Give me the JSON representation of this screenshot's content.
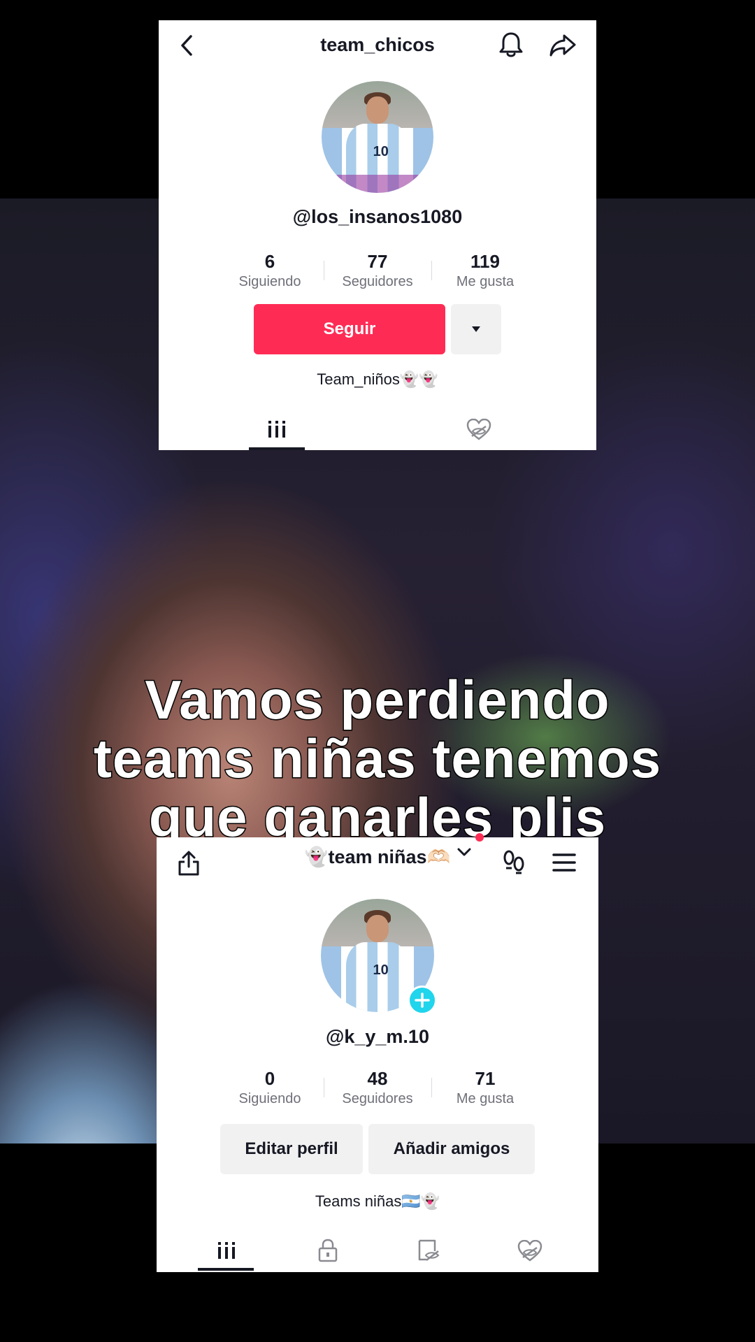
{
  "caption": {
    "line1": "Vamos perdiendo",
    "line2": "teams niñas tenemos",
    "line3": "que ganarles plis"
  },
  "top_profile": {
    "header_title": "team_chicos",
    "icons": [
      "back-arrow-icon",
      "bell-icon",
      "share-icon"
    ],
    "handle": "@los_insanos1080",
    "stats": [
      {
        "value": "6",
        "label": "Siguiendo"
      },
      {
        "value": "77",
        "label": "Seguidores"
      },
      {
        "value": "119",
        "label": "Me gusta"
      }
    ],
    "follow_label": "Seguir",
    "bio": "Team_niños👻👻",
    "tabs": [
      "videos-grid-icon",
      "liked-hidden-icon"
    ]
  },
  "bottom_profile": {
    "header_title": "👻team niñas🫶🏻",
    "icons": [
      "upload-icon",
      "chevron-down-icon",
      "footprints-icon",
      "menu-icon"
    ],
    "handle": "@k_y_m.10",
    "stats": [
      {
        "value": "0",
        "label": "Siguiendo"
      },
      {
        "value": "48",
        "label": "Seguidores"
      },
      {
        "value": "71",
        "label": "Me gusta"
      }
    ],
    "edit_label": "Editar perfil",
    "add_friends_label": "Añadir amigos",
    "bio": "Teams niñas🇦🇷👻",
    "tabs": [
      "videos-grid-icon",
      "private-lock-icon",
      "favorites-icon",
      "liked-hidden-icon"
    ]
  },
  "colors": {
    "accent": "#fe2c55",
    "add_badge": "#20d5ec",
    "text": "#161823",
    "muted": "#6f7079"
  }
}
